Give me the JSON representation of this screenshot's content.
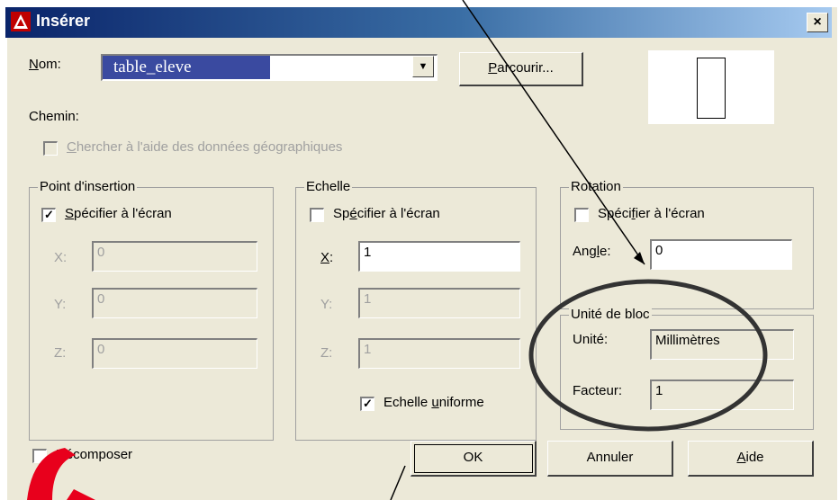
{
  "window": {
    "title": "Insérer",
    "close_label": "×"
  },
  "nom": {
    "label": "Nom:",
    "value": "table_eleve",
    "dropdown_arrow": "▼"
  },
  "browse_label": "Parcourir...",
  "chemin_label": "Chemin:",
  "geo_checkbox_label": "Chercher à l'aide des données géographiques",
  "insertion": {
    "title": "Point d'insertion",
    "specify_label": "Spécifier à l'écran",
    "x_label": "X:",
    "x_value": "0",
    "y_label": "Y:",
    "y_value": "0",
    "z_label": "Z:",
    "z_value": "0"
  },
  "echelle": {
    "title": "Echelle",
    "specify_label": "Spécifier à l'écran",
    "x_label": "X:",
    "x_value": "1",
    "y_label": "Y:",
    "y_value": "1",
    "z_label": "Z:",
    "z_value": "1",
    "uniform_label": "Echelle uniforme"
  },
  "rotation": {
    "title": "Rotation",
    "specify_label": "Spécifier à l'écran",
    "angle_label": "Angle:",
    "angle_value": "0"
  },
  "unite_bloc": {
    "title": "Unité de bloc",
    "unite_label": "Unité:",
    "unite_value": "Millimètres",
    "facteur_label": "Facteur:",
    "facteur_value": "1"
  },
  "decompose_label": "Décomposer",
  "buttons": {
    "ok": "OK",
    "cancel": "Annuler",
    "help": "Aide"
  },
  "checkmark": "✓",
  "colors": {
    "accent_title": "#0a246a",
    "annotation": "#000000",
    "logo": "#e8001c"
  }
}
